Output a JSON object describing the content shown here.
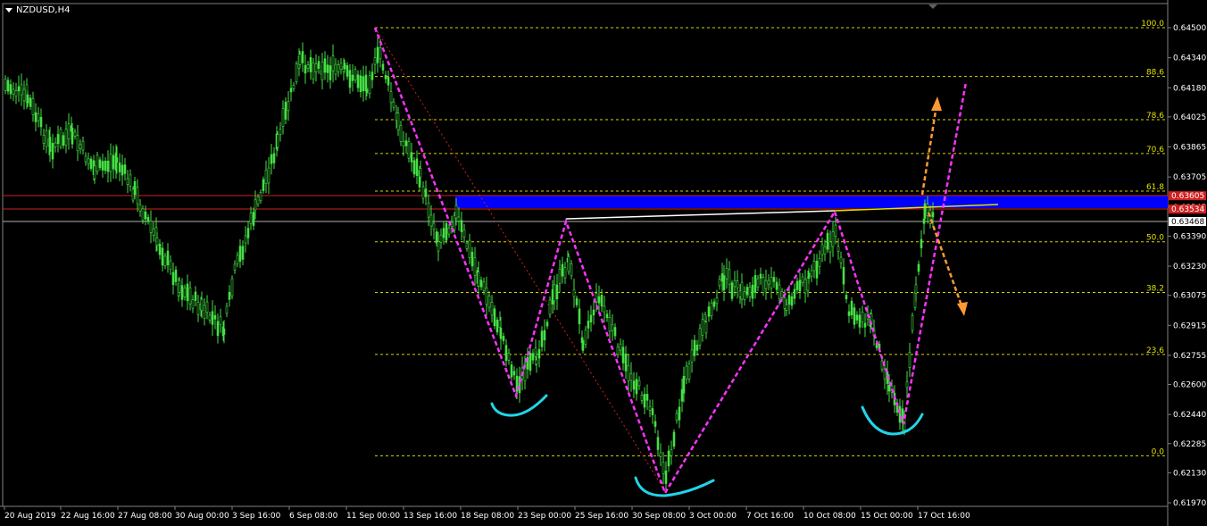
{
  "symbol": "NZDUSD,H4",
  "colors": {
    "background": "#000000",
    "candle": "#44e044",
    "fib": "#d6d600",
    "pattern": "#ff33ff",
    "brackets": "#22d4e8",
    "arrows": "#ff9933",
    "zone": "#0000ff",
    "red_line": "#d02020",
    "gray_line": "#b0b0b0"
  },
  "chart_data": {
    "type": "candlestick",
    "price_axis": [
      "0.64500",
      "0.64340",
      "0.64180",
      "0.64025",
      "0.63865",
      "0.63705",
      "0.63545",
      "0.63390",
      "0.63230",
      "0.63075",
      "0.62915",
      "0.62755",
      "0.62600",
      "0.62440",
      "0.62285",
      "0.62130",
      "0.61970"
    ],
    "time_axis": [
      "20 Aug 2019",
      "22 Aug 16:00",
      "27 Aug 08:00",
      "30 Aug 00:00",
      "3 Sep 16:00",
      "6 Sep 08:00",
      "11 Sep 00:00",
      "13 Sep 16:00",
      "18 Sep 08:00",
      "23 Sep 00:00",
      "25 Sep 16:00",
      "30 Sep 08:00",
      "3 Oct 00:00",
      "7 Oct 16:00",
      "10 Oct 08:00",
      "15 Oct 00:00",
      "17 Oct 16:00"
    ],
    "fib_levels": [
      {
        "label": "100.0",
        "price": 0.645
      },
      {
        "label": "88.6",
        "price": 0.6424
      },
      {
        "label": "78.6",
        "price": 0.6401
      },
      {
        "label": "70.6",
        "price": 0.6383
      },
      {
        "label": "61.8",
        "price": 0.6363
      },
      {
        "label": "50.0",
        "price": 0.6336
      },
      {
        "label": "38.2",
        "price": 0.6309
      },
      {
        "label": "23.6",
        "price": 0.6276
      },
      {
        "label": "0.0",
        "price": 0.6222
      }
    ],
    "price_tags": [
      {
        "label": "0.63605",
        "price": 0.63605,
        "bg": "#d02020",
        "fg": "#ffffff"
      },
      {
        "label": "0.63534",
        "price": 0.63534,
        "bg": "#d02020",
        "fg": "#ffffff"
      },
      {
        "label": "0.63468",
        "price": 0.63468,
        "bg": "#ffffff",
        "fg": "#000000"
      }
    ]
  }
}
